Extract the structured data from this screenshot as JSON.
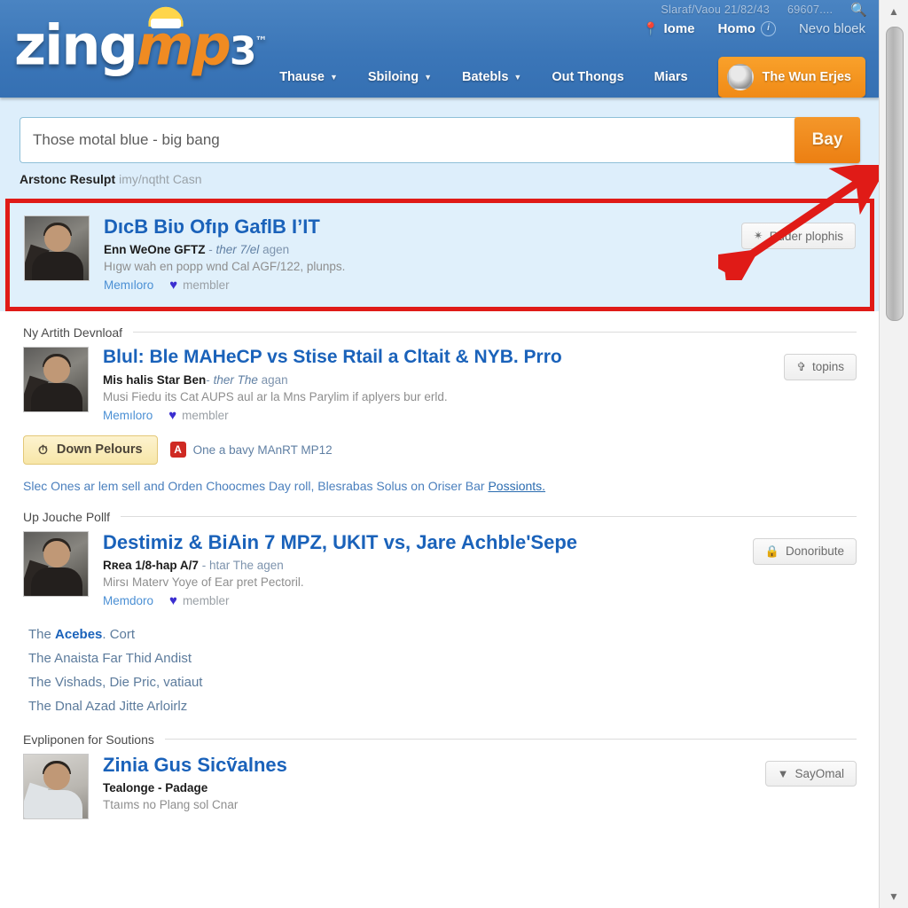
{
  "header": {
    "logo": {
      "zing": "zing",
      "mp": "mp",
      "three": "3",
      "tm": "™"
    },
    "utility": {
      "stats": "Slaraf/Vaou 21/82/43",
      "count": "69607....",
      "search_icon": "search-icon"
    },
    "top_links": [
      {
        "label": "Iome",
        "icon": "pin-icon"
      },
      {
        "label": "Homo",
        "icon": "info-circle-icon"
      },
      {
        "label": "Nevo bloek",
        "icon": ""
      }
    ],
    "nav": [
      {
        "label": "Thause",
        "caret": "▾"
      },
      {
        "label": "Sbiloing",
        "caret": "▾"
      },
      {
        "label": "Batebls",
        "caret": "▾"
      },
      {
        "label": "Out Thongs",
        "caret": ""
      },
      {
        "label": "Miars",
        "caret": ""
      }
    ],
    "cta": {
      "label": "The Wun Erjes",
      "avatar": "avatar-icon"
    }
  },
  "search": {
    "value": "Those motal blue - big bang",
    "placeholder": "Those motal blue - big bang",
    "button_label": "Bay"
  },
  "results_note": {
    "bold": "Arstonc Resulpt",
    "rest": "imy/nqtht Casn"
  },
  "highlighted_result": {
    "title": "DıcB Biʋ Ofıp GaflB IʼIT",
    "author": "Enn WeOne GFTZ",
    "sep": "-",
    "ago_italic": "ther 7/el",
    "ago": "agen",
    "desc": "Hıgw wah en popp wnd Cal AGF/122, plunps.",
    "link": "Memıloro",
    "member": "membler",
    "action": {
      "label": "Ruder plophis",
      "icon": "star-icon"
    }
  },
  "sections": [
    {
      "heading": "Ny Artith Devnloaf",
      "result": {
        "title": "Blul: Ble MAHeCP vs Stise Rtail a Cltait & NYB. Prro",
        "author": "Mis halis Star Ben",
        "sep": "-",
        "ago_italic": "ther The",
        "ago": "agan",
        "desc": "Musi Fiedu its Cat AUPS aul ar la Mns Parylim if aplyers bur erld.",
        "link": "Memıloro",
        "member": "membler",
        "action": {
          "label": "topins",
          "icon": "anchor-icon"
        }
      },
      "download": {
        "button_label": "Down Pelours",
        "button_icon": "clock-icon",
        "pdf_label": "One a bavy MAnRT MP12",
        "pdf_icon": "pdf-icon"
      },
      "paragraph": "Slec Ones ar lem sell and Orden Choocmes Day roll, Blesrabas Solus on Oriser Bar ",
      "paragraph_link": "Possionts."
    },
    {
      "heading": "Up Jouche Pollf",
      "result": {
        "title": "Destimiz & BiAin 7 MPZ, UKIT vs, Jare Achble'Sepe",
        "author": "Rʀea 1/8-hap A/7",
        "sep": "-",
        "ago_italic": "htar The",
        "ago": "agen",
        "desc": "Mirsı Materv Yoye of Ear pret Pectoril.",
        "link": "Memdoro",
        "member": "membler",
        "action": {
          "label": "Donoribute",
          "icon": "lock-icon"
        }
      },
      "links": [
        {
          "pre": "The ",
          "bold": "Acebes",
          "post": ". Cort"
        },
        {
          "pre": "The Anaista Far Thid Andist",
          "bold": "",
          "post": ""
        },
        {
          "pre": "The Vishads, Die Pric, vatiaut",
          "bold": "",
          "post": ""
        },
        {
          "pre": "The Dnal Azad Jitte Arlоirlz",
          "bold": "",
          "post": ""
        }
      ]
    },
    {
      "heading": "Evpliponen for Soutions",
      "result": {
        "title": "Zinia Gus Sicṽalnes",
        "author": "Tealonge - Padage",
        "sep": "",
        "ago_italic": "",
        "ago": "",
        "desc": "Ttaıms no Plang sol Cnar",
        "link": "",
        "member": "",
        "action": {
          "label": "SayOmal",
          "icon": "chevron-down-icon"
        }
      }
    }
  ],
  "annotations": {
    "arrow_color": "#e01b17",
    "highlight_border_color": "#e01b17",
    "highlight_bg_color": "#e0f0fb"
  },
  "scrollbar": {
    "up": "▲",
    "down": "▼"
  }
}
